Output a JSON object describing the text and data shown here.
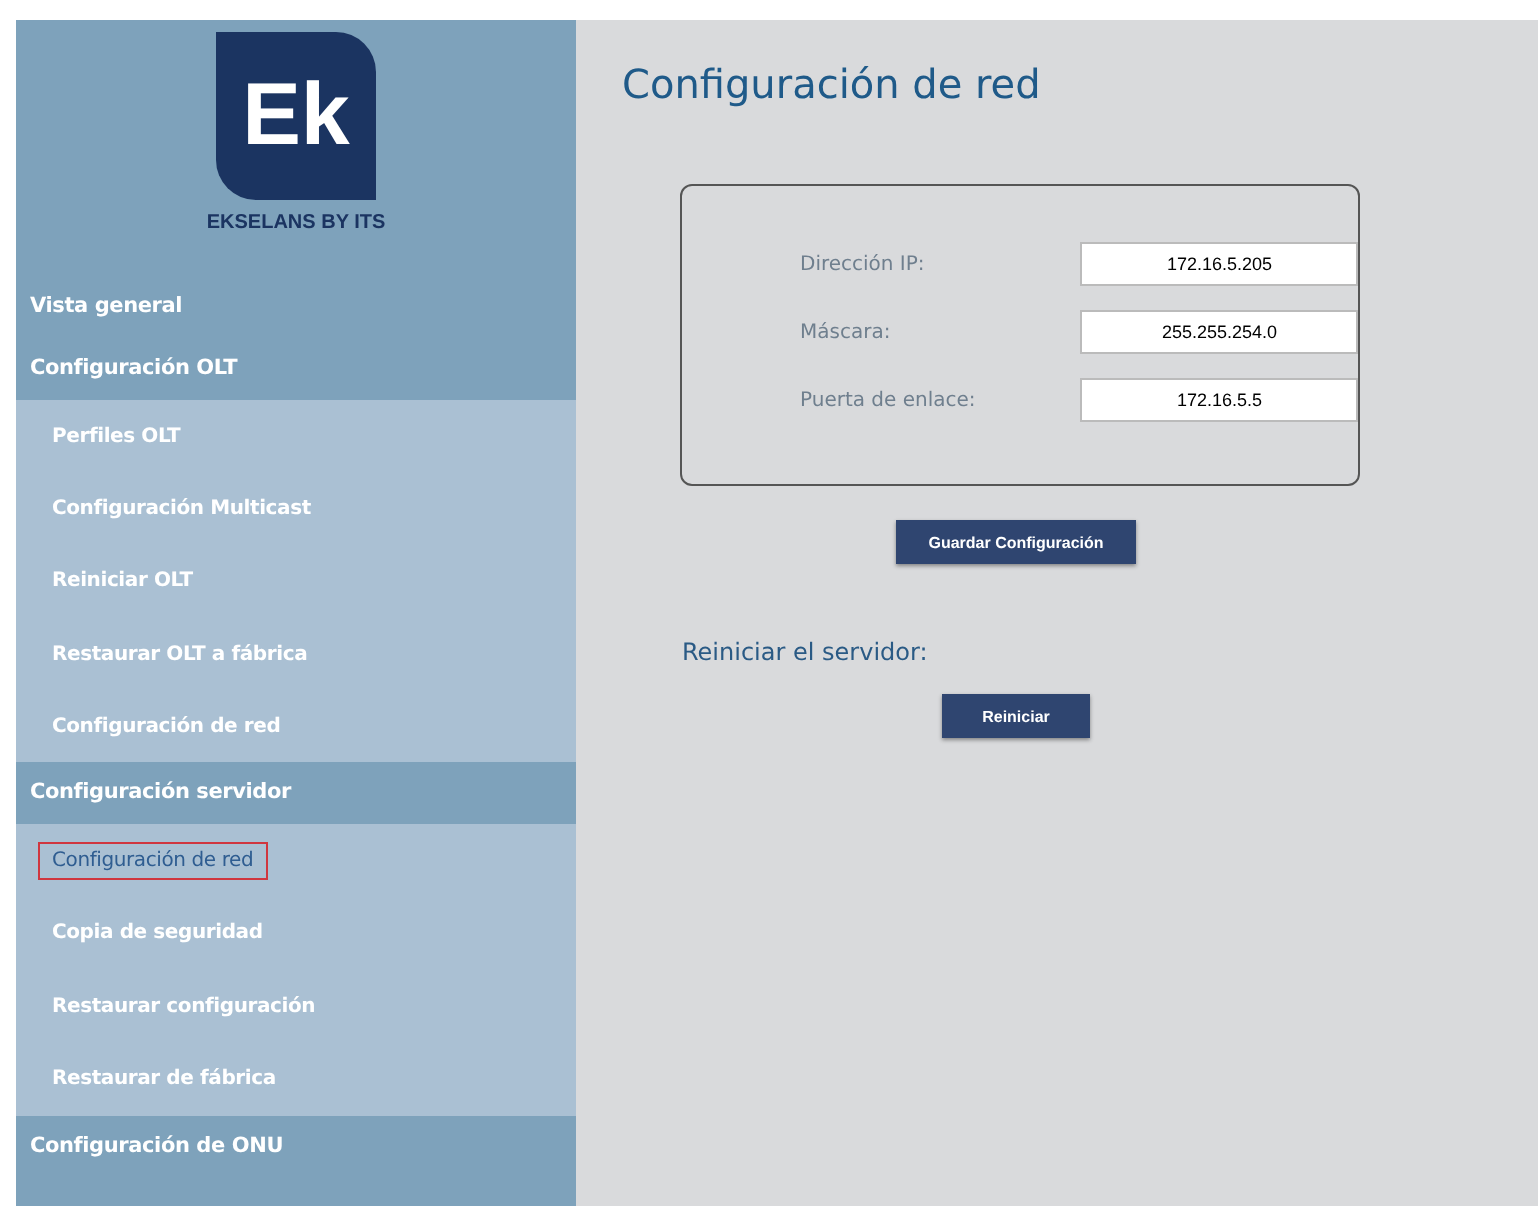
{
  "logo": {
    "mark": "Ek",
    "brand": "EKSELANS BY ITS"
  },
  "sidebar": {
    "groups": [
      {
        "label": "Vista general"
      },
      {
        "label": "Configuración OLT",
        "children": [
          {
            "label": "Perfiles OLT",
            "selected": false
          },
          {
            "label": "Configuración Multicast",
            "selected": false
          },
          {
            "label": "Reiniciar OLT",
            "selected": false
          },
          {
            "label": "Restaurar OLT a fábrica",
            "selected": false
          },
          {
            "label": "Configuración de red",
            "selected": false
          }
        ]
      },
      {
        "label": "Configuración servidor",
        "children": [
          {
            "label": "Configuración de red",
            "selected": true
          },
          {
            "label": "Copia de seguridad",
            "selected": false
          },
          {
            "label": "Restaurar configuración",
            "selected": false
          },
          {
            "label": "Restaurar de fábrica",
            "selected": false
          }
        ]
      },
      {
        "label": "Configuración de ONU"
      }
    ]
  },
  "page_title": "Configuración de red",
  "form": {
    "fields": [
      {
        "label": "Dirección IP:",
        "value": "172.16.5.205"
      },
      {
        "label": "Máscara:",
        "value": "255.255.254.0"
      },
      {
        "label": "Puerta de enlace:",
        "value": "172.16.5.5"
      }
    ],
    "save_button": "Guardar Configuración"
  },
  "restart": {
    "heading": "Reiniciar el servidor:",
    "button": "Reiniciar"
  }
}
